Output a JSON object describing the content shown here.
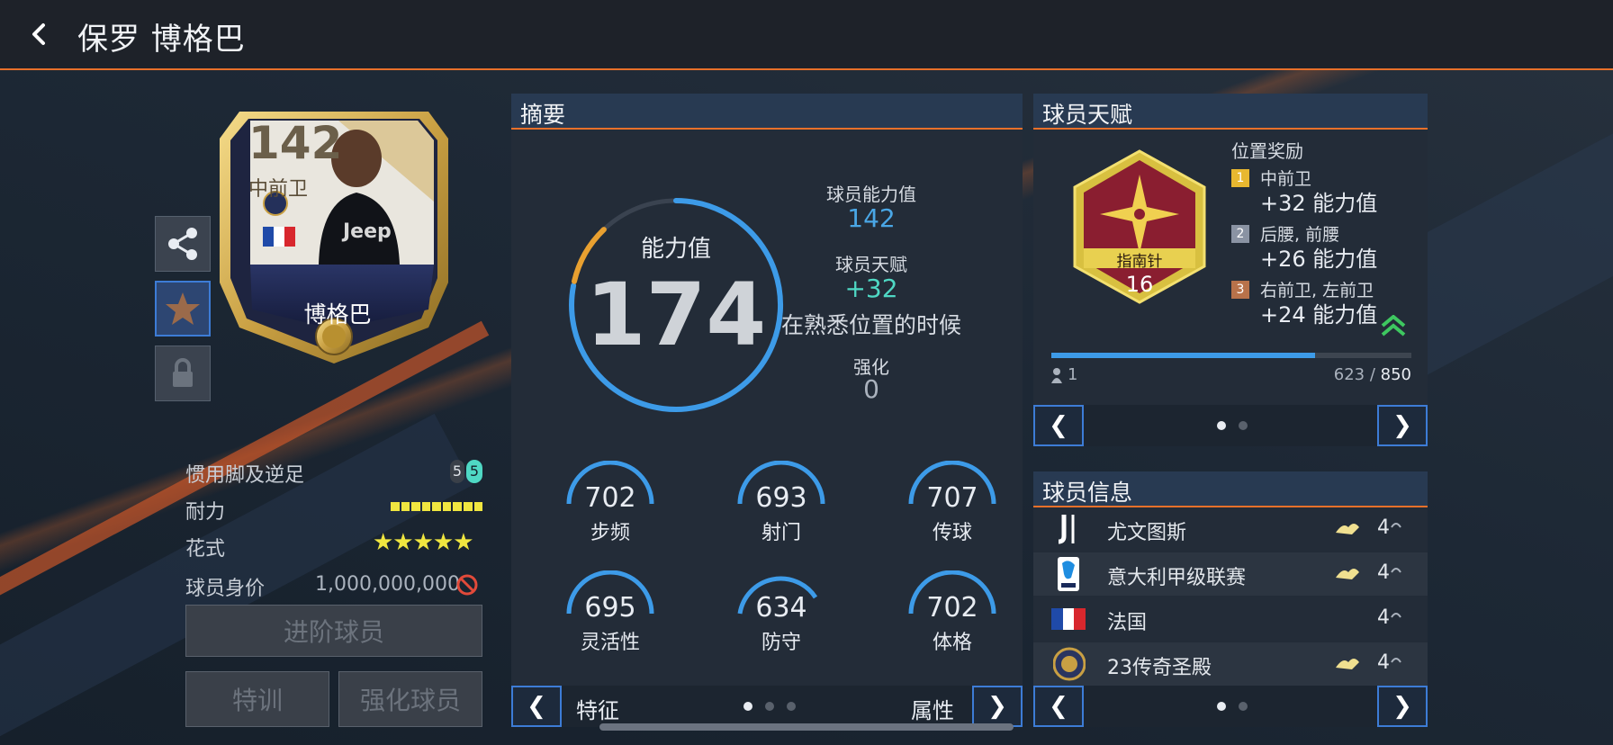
{
  "header": {
    "title": "保罗 博格巴"
  },
  "card": {
    "rating": "142",
    "position": "中前卫",
    "name": "博格巴"
  },
  "side_buttons": {
    "share": "share-icon",
    "favorite": "star-icon",
    "lock": "lock-icon"
  },
  "player_stats": {
    "foot_label": "惯用脚及逆足",
    "foot_left": "5",
    "foot_right": "5",
    "stamina_label": "耐力",
    "stamina_fill": 1.0,
    "skill_label": "花式",
    "skill_stars": "★★★★★",
    "value_label": "球员身价",
    "value": "1,000,000,000"
  },
  "buttons": {
    "advance": "进阶球员",
    "training": "特训",
    "enhance": "强化球员"
  },
  "summary": {
    "title": "摘要",
    "ovr_label": "能力值",
    "ovr_value": "174",
    "ovr_fraction": 0.78,
    "player_rating_label": "球员能力值",
    "player_rating": "142",
    "talent_label": "球员天赋",
    "talent_value": "+32",
    "talent_note": "在熟悉位置的时候",
    "enhance_label": "强化",
    "enhance_value": "0",
    "attributes": [
      {
        "value": "702",
        "label": "步频"
      },
      {
        "value": "693",
        "label": "射门"
      },
      {
        "value": "707",
        "label": "传球"
      },
      {
        "value": "695",
        "label": "灵活性"
      },
      {
        "value": "634",
        "label": "防守"
      },
      {
        "value": "702",
        "label": "体格"
      }
    ],
    "footer_left": "特征",
    "footer_right": "属性"
  },
  "talent": {
    "title": "球员天赋",
    "badge_name": "指南针",
    "badge_level": "16",
    "bonus_title": "位置奖励",
    "bonuses": [
      {
        "rank": "1",
        "positions": "中前卫",
        "bonus": "+32 能力值",
        "color": "#e8b830"
      },
      {
        "rank": "2",
        "positions": "后腰, 前腰",
        "bonus": "+26 能力值",
        "color": "#8a93a3"
      },
      {
        "rank": "3",
        "positions": "右前卫, 左前卫",
        "bonus": "+24 能力值",
        "color": "#b8724a"
      }
    ],
    "player_count": "1",
    "progress_current": "623",
    "progress_sep": " / ",
    "progress_max": "850",
    "progress_fraction": 0.733
  },
  "player_info": {
    "title": "球员信息",
    "rows": [
      {
        "name": "尤文图斯",
        "count": "4",
        "icon": "juventus-logo-icon",
        "has_hand": true
      },
      {
        "name": "意大利甲级联赛",
        "count": "4",
        "icon": "serie-a-logo-icon",
        "has_hand": true
      },
      {
        "name": "法国",
        "count": "4",
        "icon": "france-flag-icon",
        "has_hand": false
      },
      {
        "name": "23传奇圣殿",
        "count": "4",
        "icon": "legend-badge-icon",
        "has_hand": true
      }
    ]
  },
  "colors": {
    "accent_orange": "#e8702a",
    "accent_blue": "#3d9be8",
    "teal": "#4fd8c4",
    "gauge_gold": "#e8a030"
  }
}
